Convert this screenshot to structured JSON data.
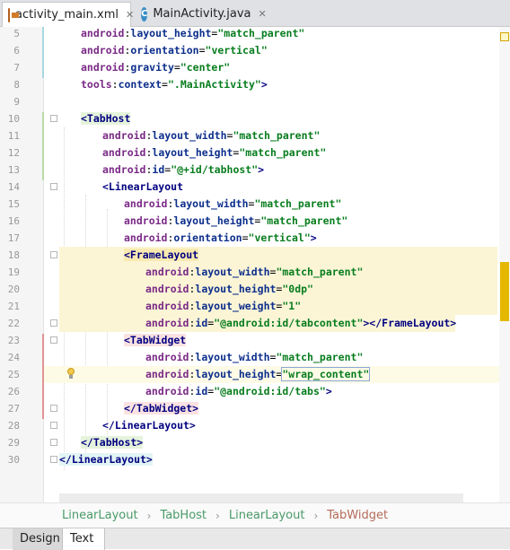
{
  "tabs": [
    {
      "label": "activity_main.xml",
      "icon": "xml-file-icon",
      "active": true
    },
    {
      "label": "MainActivity.java",
      "icon": "java-class-icon",
      "active": false
    }
  ],
  "editor": {
    "lines": [
      {
        "num": "5",
        "parts": [
          [
            "a",
            "android"
          ],
          [
            "p",
            ":"
          ],
          [
            "k",
            "layout_height"
          ],
          [
            "p",
            "="
          ],
          [
            "v",
            "\"match_parent\""
          ]
        ]
      },
      {
        "num": "6",
        "parts": [
          [
            "a",
            "android"
          ],
          [
            "p",
            ":"
          ],
          [
            "k",
            "orientation"
          ],
          [
            "p",
            "="
          ],
          [
            "v",
            "\"vertical\""
          ]
        ]
      },
      {
        "num": "7",
        "parts": [
          [
            "a",
            "android"
          ],
          [
            "p",
            ":"
          ],
          [
            "k",
            "gravity"
          ],
          [
            "p",
            "="
          ],
          [
            "v",
            "\"center\""
          ]
        ]
      },
      {
        "num": "8",
        "parts": [
          [
            "a",
            "tools"
          ],
          [
            "p",
            ":"
          ],
          [
            "k",
            "context"
          ],
          [
            "p",
            "="
          ],
          [
            "v",
            "\".MainActivity\""
          ],
          [
            "t",
            ">"
          ]
        ]
      },
      {
        "num": "9",
        "parts": []
      },
      {
        "num": "10",
        "parts": [
          [
            "t",
            "<TabHost"
          ]
        ]
      },
      {
        "num": "11",
        "parts": [
          [
            "a",
            "android"
          ],
          [
            "p",
            ":"
          ],
          [
            "k",
            "layout_width"
          ],
          [
            "p",
            "="
          ],
          [
            "v",
            "\"match_parent\""
          ]
        ]
      },
      {
        "num": "12",
        "parts": [
          [
            "a",
            "android"
          ],
          [
            "p",
            ":"
          ],
          [
            "k",
            "layout_height"
          ],
          [
            "p",
            "="
          ],
          [
            "v",
            "\"match_parent\""
          ]
        ]
      },
      {
        "num": "13",
        "parts": [
          [
            "a",
            "android"
          ],
          [
            "p",
            ":"
          ],
          [
            "k",
            "id"
          ],
          [
            "p",
            "="
          ],
          [
            "v",
            "\"@+id/tabhost\""
          ],
          [
            "t",
            ">"
          ]
        ]
      },
      {
        "num": "14",
        "parts": [
          [
            "t",
            "<LinearLayout"
          ]
        ]
      },
      {
        "num": "15",
        "parts": [
          [
            "a",
            "android"
          ],
          [
            "p",
            ":"
          ],
          [
            "k",
            "layout_width"
          ],
          [
            "p",
            "="
          ],
          [
            "v",
            "\"match_parent\""
          ]
        ]
      },
      {
        "num": "16",
        "parts": [
          [
            "a",
            "android"
          ],
          [
            "p",
            ":"
          ],
          [
            "k",
            "layout_height"
          ],
          [
            "p",
            "="
          ],
          [
            "v",
            "\"match_parent\""
          ]
        ]
      },
      {
        "num": "17",
        "parts": [
          [
            "a",
            "android"
          ],
          [
            "p",
            ":"
          ],
          [
            "k",
            "orientation"
          ],
          [
            "p",
            "="
          ],
          [
            "v",
            "\"vertical\""
          ],
          [
            "t",
            ">"
          ]
        ]
      },
      {
        "num": "18",
        "parts": [
          [
            "t",
            "<FrameLayout"
          ]
        ]
      },
      {
        "num": "19",
        "parts": [
          [
            "a",
            "android"
          ],
          [
            "p",
            ":"
          ],
          [
            "k",
            "layout_width"
          ],
          [
            "p",
            "="
          ],
          [
            "v",
            "\"match_parent\""
          ]
        ]
      },
      {
        "num": "20",
        "parts": [
          [
            "a",
            "android"
          ],
          [
            "p",
            ":"
          ],
          [
            "k",
            "layout_height"
          ],
          [
            "p",
            "="
          ],
          [
            "v",
            "\"0dp\""
          ]
        ]
      },
      {
        "num": "21",
        "parts": [
          [
            "a",
            "android"
          ],
          [
            "p",
            ":"
          ],
          [
            "k",
            "layout_weight"
          ],
          [
            "p",
            "="
          ],
          [
            "v",
            "\"1\""
          ]
        ]
      },
      {
        "num": "22",
        "parts": [
          [
            "a",
            "android"
          ],
          [
            "p",
            ":"
          ],
          [
            "k",
            "id"
          ],
          [
            "p",
            "="
          ],
          [
            "v",
            "\"@android:id/tabcontent\""
          ],
          [
            "t",
            "></FrameLayout>"
          ]
        ]
      },
      {
        "num": "23",
        "parts": [
          [
            "t",
            "<TabWidget"
          ]
        ]
      },
      {
        "num": "24",
        "parts": [
          [
            "a",
            "android"
          ],
          [
            "p",
            ":"
          ],
          [
            "k",
            "layout_width"
          ],
          [
            "p",
            "="
          ],
          [
            "v",
            "\"match_parent\""
          ]
        ]
      },
      {
        "num": "25",
        "parts": [
          [
            "a",
            "android"
          ],
          [
            "p",
            ":"
          ],
          [
            "k",
            "layout_height"
          ],
          [
            "p",
            "="
          ],
          [
            "v",
            "\"wrap_content\""
          ]
        ]
      },
      {
        "num": "26",
        "parts": [
          [
            "a",
            "android"
          ],
          [
            "p",
            ":"
          ],
          [
            "k",
            "id"
          ],
          [
            "p",
            "="
          ],
          [
            "v",
            "\"@android:id/tabs\""
          ],
          [
            "t",
            ">"
          ]
        ]
      },
      {
        "num": "27",
        "parts": [
          [
            "t",
            "</TabWidget>"
          ]
        ]
      },
      {
        "num": "28",
        "parts": [
          [
            "t",
            "</LinearLayout>"
          ]
        ]
      },
      {
        "num": "29",
        "parts": [
          [
            "t",
            "</TabHost>"
          ]
        ]
      },
      {
        "num": "30",
        "parts": [
          [
            "t",
            "</LinearLayout>"
          ]
        ]
      }
    ],
    "caret_line": "25",
    "intention_icon": "lightbulb-icon"
  },
  "breadcrumb": [
    "LinearLayout",
    "TabHost",
    "LinearLayout",
    "TabWidget"
  ],
  "bottom_tabs": [
    {
      "label": "Design",
      "active": false
    },
    {
      "label": "Text",
      "active": true
    }
  ],
  "colors": {
    "namespace": "#7a2a86",
    "attribute": "#0d2f8c",
    "value": "#087d1e",
    "tag": "#000080",
    "breadcrumb": "#4a9a68",
    "breadcrumb_last": "#b36b58"
  }
}
